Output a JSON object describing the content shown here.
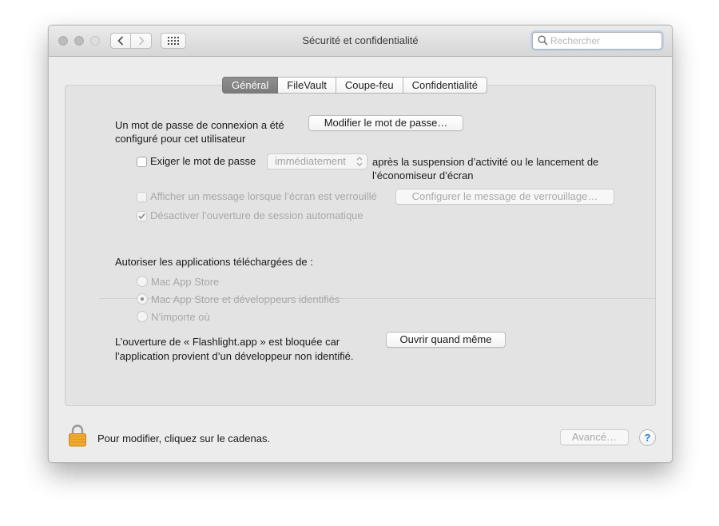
{
  "window": {
    "title": "Sécurité et confidentialité"
  },
  "search": {
    "placeholder": "Rechercher",
    "value": ""
  },
  "tabs": [
    {
      "label": "Général",
      "active": true
    },
    {
      "label": "FileVault",
      "active": false
    },
    {
      "label": "Coupe-feu",
      "active": false
    },
    {
      "label": "Confidentialité",
      "active": false
    }
  ],
  "general": {
    "password_text_line1": "Un mot de passe de connexion a été",
    "password_text_line2": "configuré pour cet utilisateur",
    "change_password_button": "Modifier le mot de passe…",
    "require_password": {
      "label": "Exiger le mot de passe",
      "checked": false,
      "select_value": "immédiatement",
      "after_line1": "après la suspension d’activité ou le lancement de",
      "after_line2": "l’économiseur d’écran"
    },
    "show_message": {
      "label": "Afficher un message lorsque l’écran est verrouillé",
      "checked": false,
      "enabled": false,
      "button": "Configurer le message de verrouillage…"
    },
    "disable_autologin": {
      "label": "Désactiver l’ouverture de session automatique",
      "checked": true,
      "enabled": false
    },
    "downloads": {
      "heading": "Autoriser les applications téléchargées de :",
      "options": [
        {
          "label": "Mac App Store",
          "selected": false
        },
        {
          "label": "Mac App Store et développeurs identifiés",
          "selected": true
        },
        {
          "label": "N’importe où",
          "selected": false
        }
      ]
    },
    "blocked": {
      "line1": "L’ouverture de « Flashlight.app » est bloquée car",
      "line2": "l’application provient d’un développeur non identifié.",
      "button": "Ouvrir quand même"
    }
  },
  "footer": {
    "lock_text": "Pour modifier, cliquez sur le cadenas.",
    "advanced_button": "Avancé…",
    "help_label": "?"
  },
  "icons": {
    "back": "chevron-left-icon",
    "forward": "chevron-right-icon",
    "show_all": "grid-icon",
    "search": "magnifier-icon",
    "lock": "padlock-icon",
    "help": "question-mark-icon"
  },
  "colors": {
    "active_tab": "#858585",
    "help_glyph": "#2a7ae2",
    "lock": "#f0a830"
  }
}
